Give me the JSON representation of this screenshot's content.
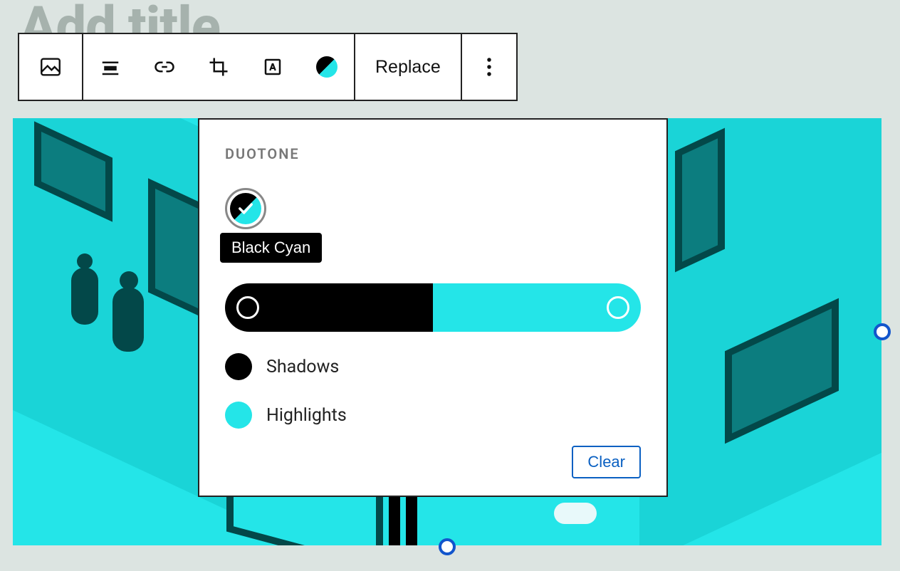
{
  "page": {
    "title_placeholder": "Add title"
  },
  "toolbar": {
    "replace_label": "Replace"
  },
  "duotone_popover": {
    "heading": "DUOTONE",
    "selected_swatch_name": "Black Cyan",
    "shadows_label": "Shadows",
    "highlights_label": "Highlights",
    "shadows_color": "#000000",
    "highlights_color": "#24e5e8",
    "clear_label": "Clear"
  }
}
